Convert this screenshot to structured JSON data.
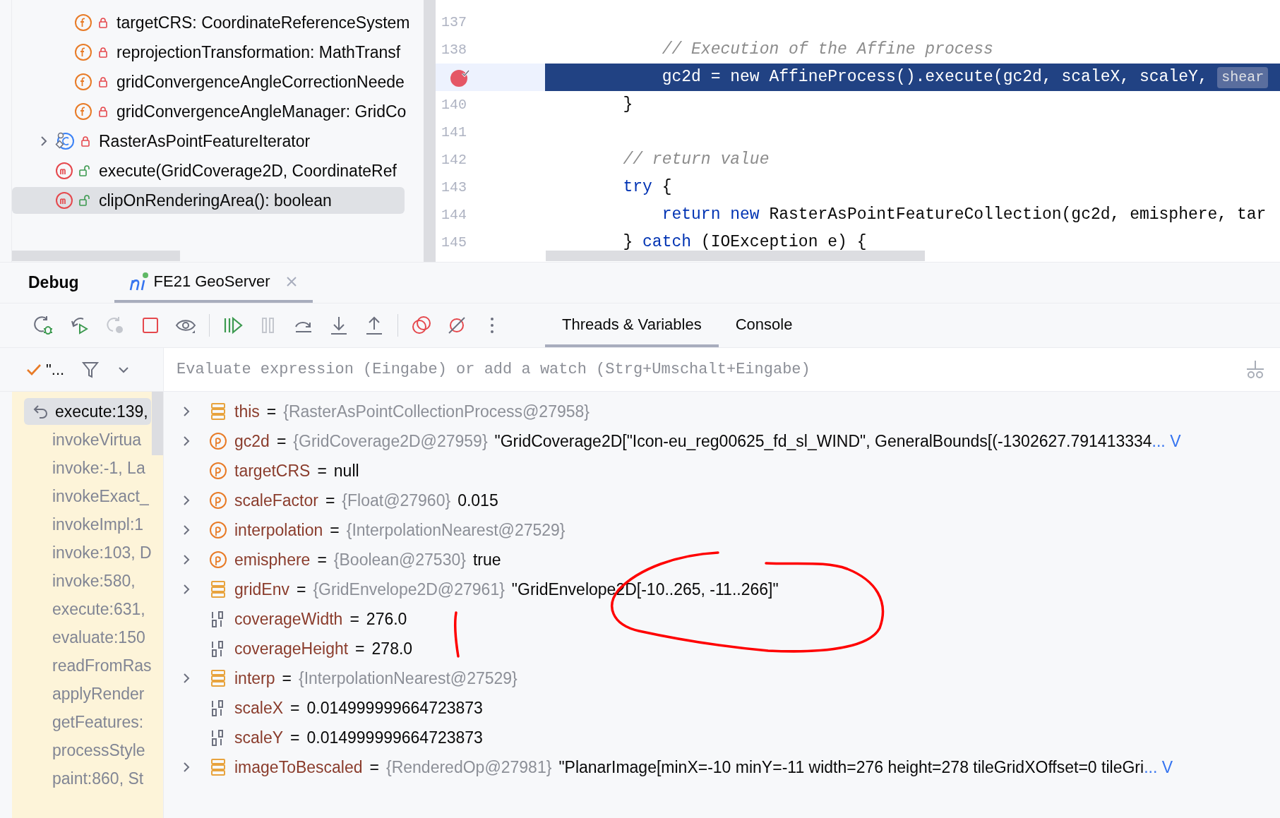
{
  "structure": {
    "items": [
      {
        "kind": "field",
        "private": true,
        "label": "targetCRS: CoordinateReferenceSystem",
        "expandable": false,
        "selected": false
      },
      {
        "kind": "field",
        "private": true,
        "label": "reprojectionTransformation: MathTransf",
        "expandable": false,
        "selected": false
      },
      {
        "kind": "field",
        "private": true,
        "label": "gridConvergenceAngleCorrectionNeede",
        "expandable": false,
        "selected": false
      },
      {
        "kind": "field",
        "private": true,
        "label": "gridConvergenceAngleManager: GridCo",
        "expandable": false,
        "selected": false
      },
      {
        "kind": "class",
        "private": true,
        "label": "RasterAsPointFeatureIterator",
        "expandable": true,
        "selected": false
      },
      {
        "kind": "method",
        "private": false,
        "label": "execute(GridCoverage2D, CoordinateRef",
        "expandable": false,
        "selected": false
      },
      {
        "kind": "method",
        "private": false,
        "label": "clipOnRenderingArea(): boolean",
        "expandable": false,
        "selected": true
      }
    ]
  },
  "editor": {
    "lines": [
      {
        "number": "137",
        "breakpoint": false,
        "current": false
      },
      {
        "number": "138",
        "breakpoint": false,
        "current": false,
        "tokens": [
          {
            "kind": "comment",
            "text": "            // Execution of the Affine process"
          }
        ]
      },
      {
        "breakpoint": true,
        "current": true,
        "tokens": [
          {
            "kind": "plain",
            "text": "            gc2d = new AffineProcess().execute(gc2d, scaleX, scaleY, "
          },
          {
            "kind": "hint",
            "text": "shear"
          }
        ]
      },
      {
        "number": "140",
        "breakpoint": false,
        "current": false,
        "tokens": [
          {
            "kind": "plain",
            "text": "        }"
          }
        ]
      },
      {
        "number": "141",
        "breakpoint": false,
        "current": false
      },
      {
        "number": "142",
        "breakpoint": false,
        "current": false,
        "tokens": [
          {
            "kind": "comment",
            "text": "        // return value"
          }
        ]
      },
      {
        "number": "143",
        "breakpoint": false,
        "current": false,
        "tokens": [
          {
            "kind": "keyword",
            "text": "        try"
          },
          {
            "kind": "plain",
            "text": " {"
          }
        ]
      },
      {
        "number": "144",
        "breakpoint": false,
        "current": false,
        "tokens": [
          {
            "kind": "keyword",
            "text": "            return new"
          },
          {
            "kind": "plain",
            "text": " RasterAsPointFeatureCollection(gc2d, emisphere, tar"
          }
        ]
      },
      {
        "number": "145",
        "breakpoint": false,
        "current": false,
        "tokens": [
          {
            "kind": "plain",
            "text": "        } "
          },
          {
            "kind": "keyword",
            "text": "catch"
          },
          {
            "kind": "plain",
            "text": " (IOException e) {"
          }
        ]
      }
    ]
  },
  "debug": {
    "title": "Debug",
    "session_tab": {
      "label": "FE21 GeoServer",
      "selected": true
    }
  },
  "toolbar": [
    [
      {
        "kind": "rerun-debug",
        "enabled": true
      },
      {
        "kind": "rerun",
        "enabled": true
      },
      {
        "kind": "restart",
        "enabled": false
      },
      {
        "kind": "stop",
        "enabled": true
      },
      {
        "kind": "watch",
        "enabled": true
      }
    ],
    [
      {
        "kind": "resume",
        "enabled": true
      },
      {
        "kind": "pause",
        "enabled": false
      },
      {
        "kind": "step-over",
        "enabled": true
      },
      {
        "kind": "step-into",
        "enabled": true
      },
      {
        "kind": "step-out",
        "enabled": true
      }
    ],
    [
      {
        "kind": "breakpoints",
        "enabled": true
      },
      {
        "kind": "mute",
        "enabled": true
      },
      {
        "kind": "more",
        "enabled": true
      }
    ]
  ],
  "view_tabs": [
    {
      "label": "Threads & Variables",
      "selected": true
    },
    {
      "label": "Console",
      "selected": false
    }
  ],
  "thread_filter": {
    "label": "\"..."
  },
  "watch": {
    "placeholder": "Evaluate expression (Eingabe) or add a watch (Strg+Umschalt+Eingabe)"
  },
  "frames": [
    {
      "label": "execute:139,",
      "selected": true
    },
    {
      "label": "invokeVirtua",
      "selected": false
    },
    {
      "label": "invoke:-1, La",
      "selected": false
    },
    {
      "label": "invokeExact_",
      "selected": false
    },
    {
      "label": "invokeImpl:1",
      "selected": false
    },
    {
      "label": "invoke:103, D",
      "selected": false
    },
    {
      "label": "invoke:580,",
      "selected": false
    },
    {
      "label": "execute:631,",
      "selected": false
    },
    {
      "label": "evaluate:150",
      "selected": false
    },
    {
      "label": "readFromRas",
      "selected": false
    },
    {
      "label": "applyRender",
      "selected": false
    },
    {
      "label": "getFeatures:",
      "selected": false
    },
    {
      "label": "processStyle",
      "selected": false
    },
    {
      "label": "paint:860, St",
      "selected": false
    }
  ],
  "variables": [
    {
      "kind": "field",
      "expandable": true,
      "name": "this",
      "operator": "=",
      "type": "{RasterAsPointCollectionProcess@27958}"
    },
    {
      "kind": "param",
      "expandable": true,
      "name": "gc2d",
      "operator": "=",
      "type": "{GridCoverage2D@27959}",
      "value": "\"GridCoverage2D[\"Icon-eu_reg00625_fd_sl_WIND\", GeneralBounds[(-1302627.791413334",
      "link": "... V"
    },
    {
      "kind": "param",
      "expandable": false,
      "name": "targetCRS",
      "operator": "=",
      "value": "null"
    },
    {
      "kind": "param",
      "expandable": true,
      "name": "scaleFactor",
      "operator": "=",
      "type": "{Float@27960}",
      "value": "0.015"
    },
    {
      "kind": "param",
      "expandable": true,
      "name": "interpolation",
      "operator": "=",
      "type": "{InterpolationNearest@27529}"
    },
    {
      "kind": "param",
      "expandable": true,
      "name": "emisphere",
      "operator": "=",
      "type": "{Boolean@27530}",
      "value": "true"
    },
    {
      "kind": "field",
      "expandable": true,
      "name": "gridEnv",
      "operator": "=",
      "type": "{GridEnvelope2D@27961}",
      "value": "\"GridEnvelope2D[-10..265, -11..266]\""
    },
    {
      "kind": "primitive",
      "expandable": false,
      "name": "coverageWidth",
      "operator": "=",
      "value": "276.0"
    },
    {
      "kind": "primitive",
      "expandable": false,
      "name": "coverageHeight",
      "operator": "=",
      "value": "278.0"
    },
    {
      "kind": "field",
      "expandable": true,
      "name": "interp",
      "operator": "=",
      "type": "{InterpolationNearest@27529}"
    },
    {
      "kind": "primitive",
      "expandable": false,
      "name": "scaleX",
      "operator": "=",
      "value": "0.014999999664723873"
    },
    {
      "kind": "primitive",
      "expandable": false,
      "name": "scaleY",
      "operator": "=",
      "value": "0.014999999664723873"
    },
    {
      "kind": "field",
      "expandable": true,
      "name": "imageToBescaled",
      "operator": "=",
      "type": "{RenderedOp@27981}",
      "value": "\"PlanarImage[minX=-10 minY=-11 width=276 height=278 tileGridXOffset=0 tileGri",
      "link": "... V"
    }
  ]
}
